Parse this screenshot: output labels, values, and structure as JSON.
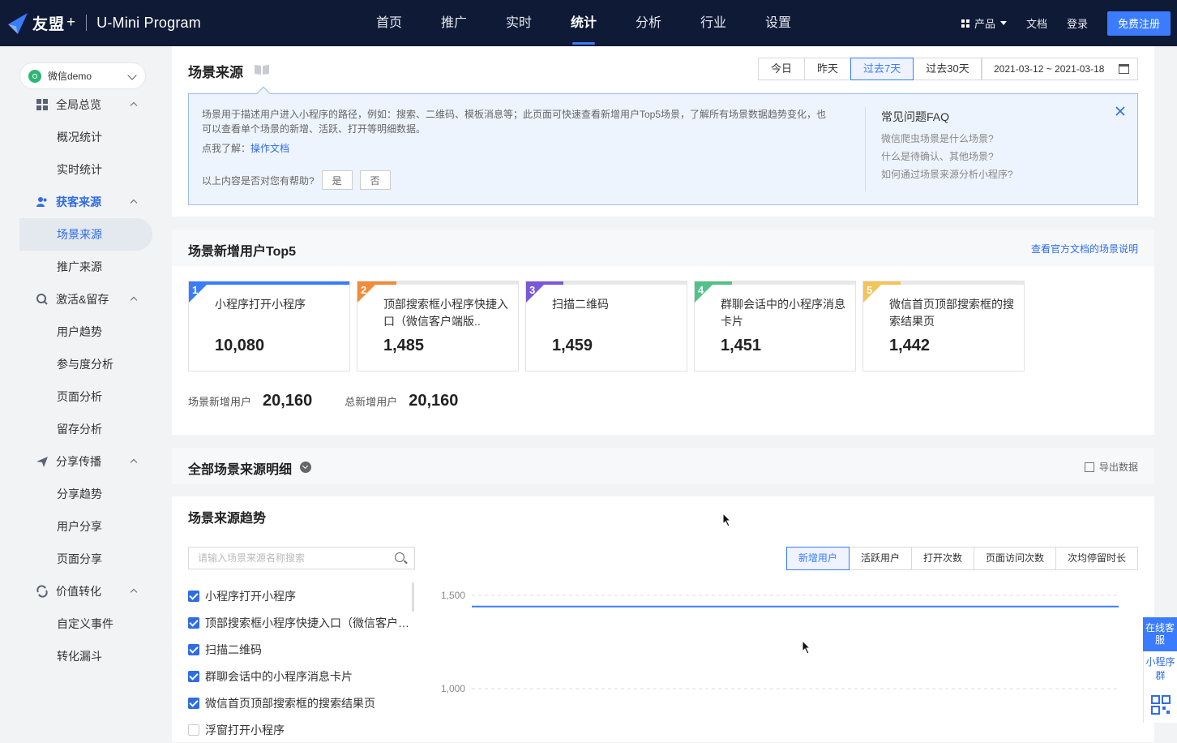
{
  "topbar": {
    "brand": "友盟",
    "brand_plus": "+",
    "product": "U-Mini Program",
    "nav": [
      "首页",
      "推广",
      "实时",
      "统计",
      "分析",
      "行业",
      "设置"
    ],
    "active_nav": "统计",
    "products_label": "产品",
    "docs_label": "文档",
    "login_label": "登录",
    "register_label": "免费注册",
    "accent": "#3b7cff",
    "bg": "#0f1a36"
  },
  "sidebar": {
    "app_name": "微信demo",
    "groups": [
      {
        "label": "全局总览",
        "icon": "dashboard-icon",
        "items": [
          "概况统计",
          "实时统计"
        ]
      },
      {
        "label": "获客来源",
        "icon": "users-icon",
        "items": [
          "场景来源",
          "推广来源"
        ]
      },
      {
        "label": "激活&留存",
        "icon": "activation-icon",
        "items": [
          "用户趋势",
          "参与度分析",
          "页面分析",
          "留存分析"
        ]
      },
      {
        "label": "分享传播",
        "icon": "share-icon",
        "items": [
          "分享趋势",
          "用户分享",
          "页面分享"
        ]
      },
      {
        "label": "价值转化",
        "icon": "conversion-icon",
        "items": [
          "自定义事件",
          "转化漏斗"
        ]
      }
    ],
    "active_item": "场景来源"
  },
  "page": {
    "title": "场景来源",
    "date_buttons": [
      "今日",
      "昨天",
      "过去7天",
      "过去30天"
    ],
    "active_date": "过去7天",
    "date_range": "2021-03-12 ~ 2021-03-18"
  },
  "notice": {
    "text": "场景用于描述用户进入小程序的路径，例如：搜索、二维码、模板消息等；此页面可快速查看新增用户Top5场景，了解所有场景数据趋势变化，也可以查看单个场景的新增、活跃、打开等明细数据。",
    "learn_prefix": "点我了解：",
    "learn_link": "操作文档",
    "helpful_q": "以上内容是否对您有帮助?",
    "yes": "是",
    "no": "否",
    "faq_title": "常见问题FAQ",
    "faq": [
      "微信爬虫场景是什么场景?",
      "什么是待确认、其他场景?",
      "如何通过场景来源分析小程序?"
    ]
  },
  "top5": {
    "title": "场景新增用户Top5",
    "doc_link": "查看官方文档的场景说明",
    "cards": [
      {
        "rank": "1",
        "name": "小程序打开小程序",
        "value": "10,080",
        "color": "#3b7cff",
        "share": 1.0
      },
      {
        "rank": "2",
        "name": "顶部搜索框小程序快捷入口（微信客户端版..",
        "value": "1,485",
        "color": "#f08c3a",
        "share": 0.24
      },
      {
        "rank": "3",
        "name": "扫描二维码",
        "value": "1,459",
        "color": "#7a58d6",
        "share": 0.23
      },
      {
        "rank": "4",
        "name": "群聊会话中的小程序消息卡片",
        "value": "1,451",
        "color": "#52c28a",
        "share": 0.23
      },
      {
        "rank": "5",
        "name": "微信首页顶部搜索框的搜索结果页",
        "value": "1,442",
        "color": "#f3c45a",
        "share": 0.23
      }
    ],
    "scene_new_label": "场景新增用户",
    "scene_new_value": "20,160",
    "total_new_label": "总新增用户",
    "total_new_value": "20,160"
  },
  "detail": {
    "title": "全部场景来源明细",
    "export_label": "导出数据"
  },
  "trend": {
    "title": "场景来源趋势",
    "search_placeholder": "请输入场景来源名称搜索",
    "scenes": [
      {
        "label": "小程序打开小程序",
        "checked": true
      },
      {
        "label": "顶部搜索框小程序快捷入口（微信客户…",
        "checked": true
      },
      {
        "label": "扫描二维码",
        "checked": true
      },
      {
        "label": "群聊会话中的小程序消息卡片",
        "checked": true
      },
      {
        "label": "微信首页顶部搜索框的搜索结果页",
        "checked": true
      },
      {
        "label": "浮窗打开小程序",
        "checked": false
      }
    ],
    "metric_tabs": [
      "新增用户",
      "活跃用户",
      "打开次数",
      "页面访问次数",
      "次均停留时长"
    ],
    "active_metric": "新增用户"
  },
  "chart_data": {
    "type": "line",
    "yticks": [
      1500,
      1000
    ],
    "ylim": [
      1000,
      1500
    ],
    "series": [
      {
        "values": [
          1440,
          1440,
          1440,
          1440,
          1440,
          1440,
          1440
        ]
      }
    ]
  },
  "float_panel": {
    "online_service": "在线客服",
    "mini_group": "小程序群"
  }
}
